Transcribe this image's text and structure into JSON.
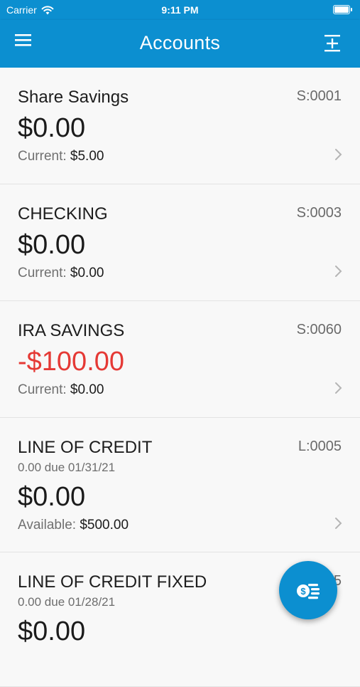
{
  "status_bar": {
    "carrier": "Carrier",
    "time": "9:11 PM"
  },
  "header": {
    "title": "Accounts"
  },
  "accounts": [
    {
      "name": "Share Savings",
      "number": "S:0001",
      "balance": "$0.00",
      "sub_label": "Current:",
      "sub_value": "$5.00"
    },
    {
      "name": "CHECKING",
      "number": "S:0003",
      "balance": "$0.00",
      "sub_label": "Current:",
      "sub_value": "$0.00"
    },
    {
      "name": "IRA SAVINGS",
      "number": "S:0060",
      "balance": "-$100.00",
      "sub_label": "Current:",
      "sub_value": "$0.00"
    },
    {
      "name": "LINE OF CREDIT",
      "number": "L:0005",
      "due": "0.00 due 01/31/21",
      "balance": "$0.00",
      "sub_label": "Available:",
      "sub_value": "$500.00"
    },
    {
      "name": "LINE OF CREDIT FIXED",
      "number": "5",
      "due": "0.00 due 01/28/21",
      "balance": "$0.00"
    }
  ],
  "colors": {
    "brand": "#0c8fd0",
    "negative": "#e53935"
  },
  "icons": {
    "menu": "hamburger-icon",
    "expand": "expand-collapse-icon",
    "fab": "transfer-money-icon"
  }
}
